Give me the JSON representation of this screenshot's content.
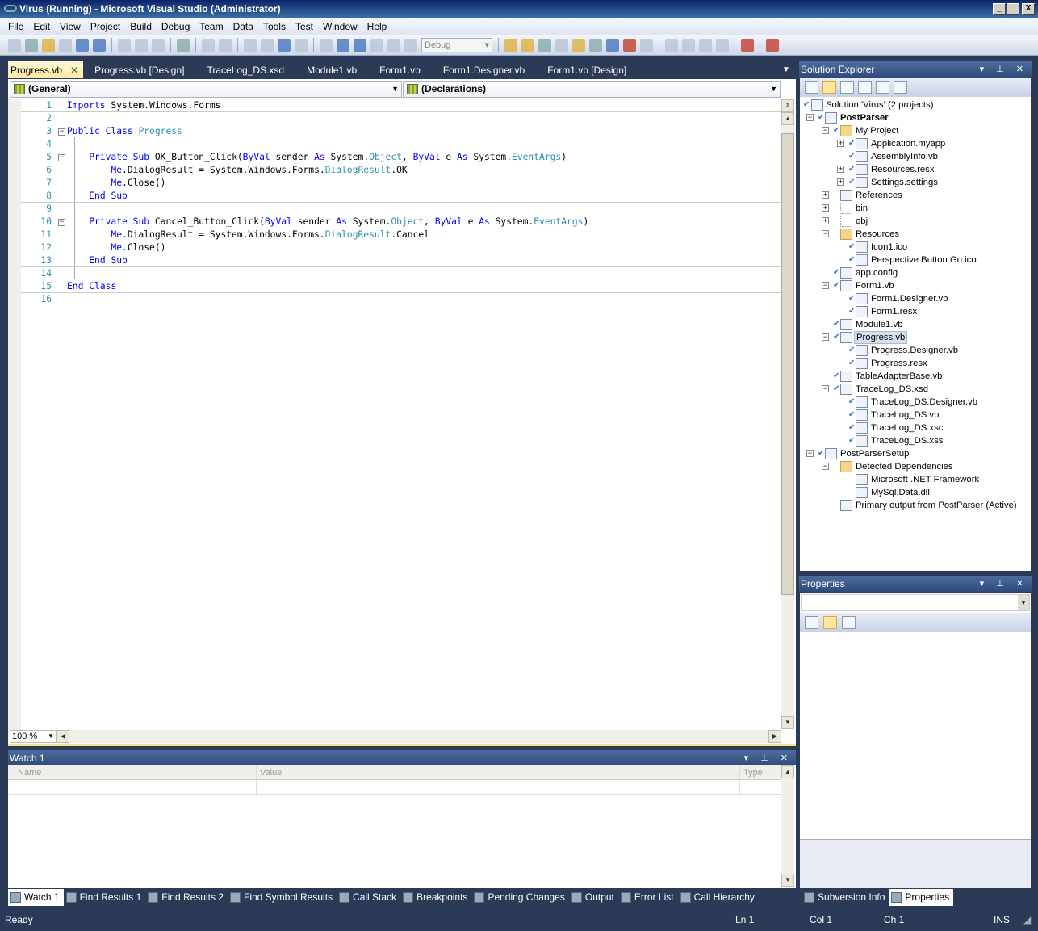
{
  "window": {
    "title": "Virus (Running) - Microsoft Visual Studio (Administrator)",
    "controls": [
      "_",
      "□",
      "X"
    ]
  },
  "menu": [
    "File",
    "Edit",
    "View",
    "Project",
    "Build",
    "Debug",
    "Team",
    "Data",
    "Tools",
    "Test",
    "Window",
    "Help"
  ],
  "toolbar": {
    "configuration": "Debug"
  },
  "doc_tabs": [
    "Progress.vb",
    "Progress.vb [Design]",
    "TraceLog_DS.xsd",
    "Module1.vb",
    "Form1.vb",
    "Form1.Designer.vb",
    "Form1.vb [Design]"
  ],
  "editor": {
    "class_combo": "(General)",
    "member_combo": "(Declarations)",
    "zoom": "100 %",
    "lines": [
      {
        "n": "1",
        "fold": "",
        "sep": true,
        "tokens": [
          [
            "Imports",
            "kw"
          ],
          [
            " System.Windows.Forms",
            ""
          ]
        ]
      },
      {
        "n": "2",
        "tokens": []
      },
      {
        "n": "3",
        "fold": "−",
        "tokens": [
          [
            "Public",
            "kw"
          ],
          [
            " ",
            ""
          ],
          [
            "Class",
            "kw"
          ],
          [
            " ",
            ""
          ],
          [
            "Progress",
            "ty"
          ]
        ]
      },
      {
        "n": "4",
        "tokens": []
      },
      {
        "n": "5",
        "fold": "−",
        "tokens": [
          [
            "    ",
            ""
          ],
          [
            "Private",
            "kw"
          ],
          [
            " ",
            ""
          ],
          [
            "Sub",
            "kw"
          ],
          [
            " OK_Button_Click(",
            ""
          ],
          [
            "ByVal",
            "kw"
          ],
          [
            " sender ",
            ""
          ],
          [
            "As",
            "kw"
          ],
          [
            " System.",
            ""
          ],
          [
            "Object",
            "ty"
          ],
          [
            ", ",
            ""
          ],
          [
            "ByVal",
            "kw"
          ],
          [
            " e ",
            ""
          ],
          [
            "As",
            "kw"
          ],
          [
            " System.",
            ""
          ],
          [
            "EventArgs",
            "ty"
          ],
          [
            ")",
            ""
          ]
        ]
      },
      {
        "n": "6",
        "tokens": [
          [
            "        ",
            ""
          ],
          [
            "Me",
            "kw"
          ],
          [
            ".DialogResult = System.Windows.Forms.",
            ""
          ],
          [
            "DialogResult",
            "ty"
          ],
          [
            ".OK",
            ""
          ]
        ]
      },
      {
        "n": "7",
        "tokens": [
          [
            "        ",
            ""
          ],
          [
            "Me",
            "kw"
          ],
          [
            ".Close()",
            ""
          ]
        ]
      },
      {
        "n": "8",
        "sep": true,
        "tokens": [
          [
            "    ",
            ""
          ],
          [
            "End",
            "kw"
          ],
          [
            " ",
            ""
          ],
          [
            "Sub",
            "kw"
          ]
        ]
      },
      {
        "n": "9",
        "tokens": []
      },
      {
        "n": "10",
        "fold": "−",
        "tokens": [
          [
            "    ",
            ""
          ],
          [
            "Private",
            "kw"
          ],
          [
            " ",
            ""
          ],
          [
            "Sub",
            "kw"
          ],
          [
            " Cancel_Button_Click(",
            ""
          ],
          [
            "ByVal",
            "kw"
          ],
          [
            " sender ",
            ""
          ],
          [
            "As",
            "kw"
          ],
          [
            " System.",
            ""
          ],
          [
            "Object",
            "ty"
          ],
          [
            ", ",
            ""
          ],
          [
            "ByVal",
            "kw"
          ],
          [
            " e ",
            ""
          ],
          [
            "As",
            "kw"
          ],
          [
            " System.",
            ""
          ],
          [
            "EventArgs",
            "ty"
          ],
          [
            ")",
            ""
          ]
        ]
      },
      {
        "n": "11",
        "tokens": [
          [
            "        ",
            ""
          ],
          [
            "Me",
            "kw"
          ],
          [
            ".DialogResult = System.Windows.Forms.",
            ""
          ],
          [
            "DialogResult",
            "ty"
          ],
          [
            ".Cancel",
            ""
          ]
        ]
      },
      {
        "n": "12",
        "tokens": [
          [
            "        ",
            ""
          ],
          [
            "Me",
            "kw"
          ],
          [
            ".Close()",
            ""
          ]
        ]
      },
      {
        "n": "13",
        "sep": true,
        "tokens": [
          [
            "    ",
            ""
          ],
          [
            "End",
            "kw"
          ],
          [
            " ",
            ""
          ],
          [
            "Sub",
            "kw"
          ]
        ]
      },
      {
        "n": "14",
        "tokens": []
      },
      {
        "n": "15",
        "sep": true,
        "tokens": [
          [
            "End",
            "kw"
          ],
          [
            " ",
            ""
          ],
          [
            "Class",
            "kw"
          ]
        ]
      },
      {
        "n": "16",
        "tokens": []
      }
    ]
  },
  "watch": {
    "title": "Watch 1",
    "columns": [
      "Name",
      "Value",
      "Type"
    ]
  },
  "bottom_tabs": [
    "Watch 1",
    "Find Results 1",
    "Find Results 2",
    "Find Symbol Results",
    "Call Stack",
    "Breakpoints",
    "Pending Changes",
    "Output",
    "Error List",
    "Call Hierarchy"
  ],
  "right_tabs": [
    "Subversion Info",
    "Properties"
  ],
  "status": {
    "text": "Ready",
    "ln": "Ln 1",
    "col": "Col 1",
    "ch": "Ch 1",
    "mode": "INS"
  },
  "solution_explorer": {
    "title": "Solution Explorer",
    "items": [
      {
        "d": 0,
        "label": "Solution 'Virus' (2 projects)",
        "exp": "",
        "chk": true,
        "icon": "solution"
      },
      {
        "d": 1,
        "label": "PostParser",
        "exp": "−",
        "chk": true,
        "bold": true,
        "icon": "vb-project"
      },
      {
        "d": 2,
        "label": "My Project",
        "exp": "−",
        "chk": true,
        "icon": "folder"
      },
      {
        "d": 3,
        "label": "Application.myapp",
        "exp": "+",
        "chk": true,
        "icon": "file"
      },
      {
        "d": 3,
        "label": "AssemblyInfo.vb",
        "exp": "",
        "chk": true,
        "icon": "file"
      },
      {
        "d": 3,
        "label": "Resources.resx",
        "exp": "+",
        "chk": true,
        "icon": "file"
      },
      {
        "d": 3,
        "label": "Settings.settings",
        "exp": "+",
        "chk": true,
        "icon": "file"
      },
      {
        "d": 2,
        "label": "References",
        "exp": "+",
        "chk": false,
        "icon": "references"
      },
      {
        "d": 2,
        "label": "bin",
        "exp": "+",
        "chk": false,
        "icon": "empty"
      },
      {
        "d": 2,
        "label": "obj",
        "exp": "+",
        "chk": false,
        "icon": "empty"
      },
      {
        "d": 2,
        "label": "Resources",
        "exp": "−",
        "chk": false,
        "icon": "folder"
      },
      {
        "d": 3,
        "label": "Icon1.ico",
        "exp": "",
        "chk": true,
        "icon": "file"
      },
      {
        "d": 3,
        "label": "Perspective Button Go.ico",
        "exp": "",
        "chk": true,
        "icon": "file"
      },
      {
        "d": 2,
        "label": "app.config",
        "exp": "",
        "chk": true,
        "icon": "file"
      },
      {
        "d": 2,
        "label": "Form1.vb",
        "exp": "−",
        "chk": true,
        "icon": "file"
      },
      {
        "d": 3,
        "label": "Form1.Designer.vb",
        "exp": "",
        "chk": true,
        "icon": "file"
      },
      {
        "d": 3,
        "label": "Form1.resx",
        "exp": "",
        "chk": true,
        "icon": "file"
      },
      {
        "d": 2,
        "label": "Module1.vb",
        "exp": "",
        "chk": true,
        "icon": "file"
      },
      {
        "d": 2,
        "label": "Progress.vb",
        "exp": "−",
        "chk": true,
        "icon": "file",
        "sel": true
      },
      {
        "d": 3,
        "label": "Progress.Designer.vb",
        "exp": "",
        "chk": true,
        "icon": "file"
      },
      {
        "d": 3,
        "label": "Progress.resx",
        "exp": "",
        "chk": true,
        "icon": "file"
      },
      {
        "d": 2,
        "label": "TableAdapterBase.vb",
        "exp": "",
        "chk": true,
        "icon": "file"
      },
      {
        "d": 2,
        "label": "TraceLog_DS.xsd",
        "exp": "−",
        "chk": true,
        "icon": "file"
      },
      {
        "d": 3,
        "label": "TraceLog_DS.Designer.vb",
        "exp": "",
        "chk": true,
        "icon": "file"
      },
      {
        "d": 3,
        "label": "TraceLog_DS.vb",
        "exp": "",
        "chk": true,
        "icon": "file"
      },
      {
        "d": 3,
        "label": "TraceLog_DS.xsc",
        "exp": "",
        "chk": true,
        "icon": "file"
      },
      {
        "d": 3,
        "label": "TraceLog_DS.xss",
        "exp": "",
        "chk": true,
        "icon": "file"
      },
      {
        "d": 1,
        "label": "PostParserSetup",
        "exp": "−",
        "chk": true,
        "icon": "setup-project"
      },
      {
        "d": 2,
        "label": "Detected Dependencies",
        "exp": "−",
        "chk": false,
        "icon": "folder"
      },
      {
        "d": 3,
        "label": "Microsoft .NET Framework",
        "exp": "",
        "chk": false,
        "icon": "dependency"
      },
      {
        "d": 3,
        "label": "MySql.Data.dll",
        "exp": "",
        "chk": false,
        "icon": "dependency"
      },
      {
        "d": 2,
        "label": "Primary output from PostParser (Active)",
        "exp": "",
        "chk": false,
        "icon": "output"
      }
    ]
  },
  "properties": {
    "title": "Properties"
  },
  "colors": {
    "keyword": "#0000ff",
    "type": "#2b91af",
    "chrome": "#2a3a57",
    "active_tab": "#ffe8a0"
  }
}
